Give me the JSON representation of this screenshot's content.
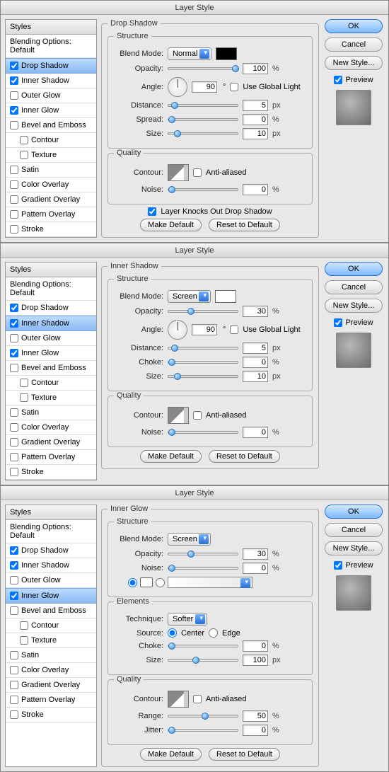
{
  "common": {
    "title": "Layer Style",
    "ok": "OK",
    "cancel": "Cancel",
    "new_style": "New Style...",
    "preview": "Preview",
    "make_default": "Make Default",
    "reset_default": "Reset to Default",
    "styles_header": "Styles",
    "blending_header": "Blending Options: Default",
    "structure": "Structure",
    "quality": "Quality",
    "elements": "Elements",
    "blend_mode": "Blend Mode:",
    "opacity": "Opacity:",
    "angle": "Angle:",
    "use_global": "Use Global Light",
    "distance": "Distance:",
    "spread": "Spread:",
    "choke": "Choke:",
    "size": "Size:",
    "contour": "Contour:",
    "anti_aliased": "Anti-aliased",
    "noise": "Noise:",
    "technique": "Technique:",
    "source": "Source:",
    "center": "Center",
    "edge": "Edge",
    "range": "Range:",
    "jitter": "Jitter:",
    "px": "px",
    "pct": "%",
    "layer_knocks": "Layer Knocks Out Drop Shadow"
  },
  "side_items": [
    {
      "key": "drop_shadow",
      "label": "Drop Shadow"
    },
    {
      "key": "inner_shadow",
      "label": "Inner Shadow"
    },
    {
      "key": "outer_glow",
      "label": "Outer Glow"
    },
    {
      "key": "inner_glow",
      "label": "Inner Glow"
    },
    {
      "key": "bevel",
      "label": "Bevel and Emboss"
    },
    {
      "key": "contour",
      "label": "Contour",
      "sub": true
    },
    {
      "key": "texture",
      "label": "Texture",
      "sub": true
    },
    {
      "key": "satin",
      "label": "Satin"
    },
    {
      "key": "color_overlay",
      "label": "Color Overlay"
    },
    {
      "key": "gradient_overlay",
      "label": "Gradient Overlay"
    },
    {
      "key": "pattern_overlay",
      "label": "Pattern Overlay"
    },
    {
      "key": "stroke",
      "label": "Stroke"
    }
  ],
  "d1": {
    "title": "Drop Shadow",
    "selected": "drop_shadow",
    "checked": [
      "drop_shadow",
      "inner_shadow",
      "inner_glow"
    ],
    "blend_mode": "Normal",
    "color": "#000000",
    "opacity": 100,
    "angle": 90,
    "use_global": false,
    "distance": 5,
    "spread": 0,
    "size": 10,
    "anti_aliased": false,
    "noise": 0,
    "knocks": true
  },
  "d2": {
    "title": "Inner Shadow",
    "selected": "inner_shadow",
    "checked": [
      "drop_shadow",
      "inner_shadow",
      "inner_glow"
    ],
    "blend_mode": "Screen",
    "color": "#ffffff",
    "opacity": 30,
    "angle": 90,
    "use_global": false,
    "distance": 5,
    "choke": 0,
    "size": 10,
    "anti_aliased": false,
    "noise": 0
  },
  "d3": {
    "title": "Inner Glow",
    "selected": "inner_glow",
    "checked": [
      "drop_shadow",
      "inner_shadow",
      "inner_glow"
    ],
    "blend_mode": "Screen",
    "opacity": 30,
    "noise": 0,
    "technique": "Softer",
    "source": "Center",
    "choke": 0,
    "size": 100,
    "anti_aliased": false,
    "range": 50,
    "jitter": 0
  }
}
